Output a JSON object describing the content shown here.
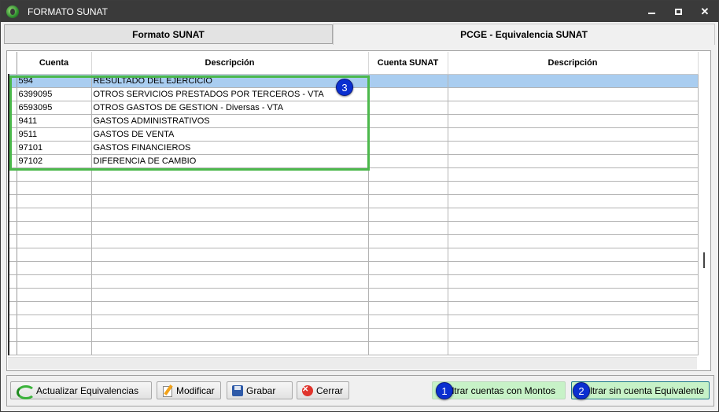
{
  "window": {
    "title": "FORMATO SUNAT",
    "icons": {
      "minimize": "minimize-icon",
      "maximize": "maximize-icon",
      "close": "close-icon"
    },
    "close_glyph": "✕"
  },
  "tabs": [
    {
      "label": "Formato SUNAT",
      "active": false
    },
    {
      "label": "PCGE - Equivalencia SUNAT",
      "active": true
    }
  ],
  "grid": {
    "columns": [
      "Cuenta",
      "Descripción",
      "Cuenta SUNAT",
      "Descripción"
    ],
    "rows": [
      {
        "cuenta": "594",
        "descripcion": "RESULTADO DEL EJERCICIO",
        "cuenta_sunat": "",
        "descripcion_sunat": "",
        "selected": true
      },
      {
        "cuenta": "6399095",
        "descripcion": "OTROS SERVICIOS PRESTADOS POR TERCEROS - VTA",
        "cuenta_sunat": "",
        "descripcion_sunat": ""
      },
      {
        "cuenta": "6593095",
        "descripcion": "OTROS GASTOS DE GESTION - Diversas - VTA",
        "cuenta_sunat": "",
        "descripcion_sunat": ""
      },
      {
        "cuenta": "9411",
        "descripcion": "GASTOS ADMINISTRATIVOS",
        "cuenta_sunat": "",
        "descripcion_sunat": ""
      },
      {
        "cuenta": "9511",
        "descripcion": "GASTOS DE VENTA",
        "cuenta_sunat": "",
        "descripcion_sunat": ""
      },
      {
        "cuenta": "97101",
        "descripcion": "GASTOS FINANCIEROS",
        "cuenta_sunat": "",
        "descripcion_sunat": ""
      },
      {
        "cuenta": "97102",
        "descripcion": "DIFERENCIA DE CAMBIO",
        "cuenta_sunat": "",
        "descripcion_sunat": ""
      }
    ],
    "selected_row_color": "#a9cdf0"
  },
  "annotations": {
    "badge_1": "1",
    "badge_2": "2",
    "badge_3": "3",
    "highlight_color": "#4cb84c",
    "badge_color": "#0a2fd0"
  },
  "buttons": {
    "actualizar": {
      "label": "Actualizar Equivalencias",
      "icon": "refresh-icon"
    },
    "modificar": {
      "label": "Modificar",
      "icon": "pencil-icon"
    },
    "grabar": {
      "label": "Grabar",
      "icon": "floppy-disk-icon"
    },
    "cerrar": {
      "label": "Cerrar",
      "icon": "close-circle-icon",
      "glyph": "✕"
    },
    "filtrar_montos": {
      "label": "Filtrar cuentas con Montos"
    },
    "filtrar_equivalente": {
      "label": "Filtrar sin cuenta Equivalente"
    },
    "filter_color": "#c7f2c7"
  }
}
